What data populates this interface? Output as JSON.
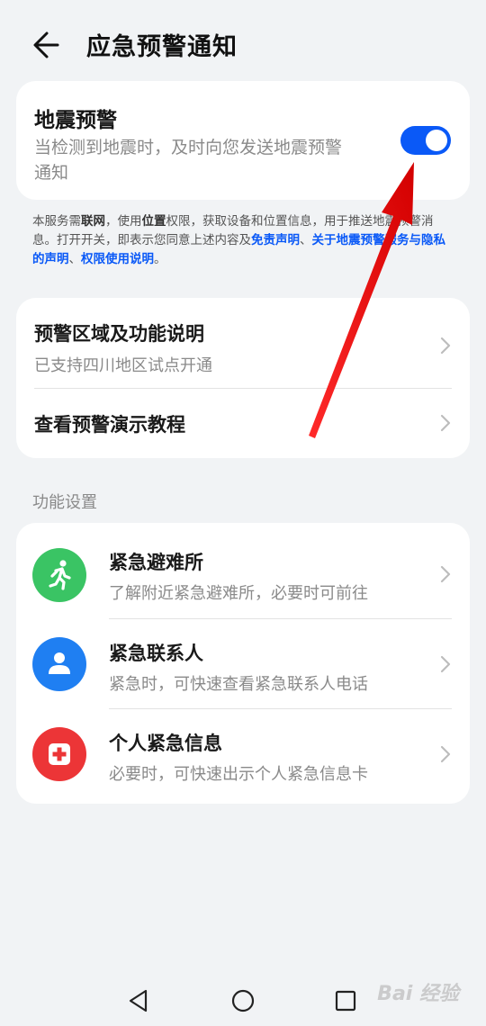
{
  "header": {
    "title": "应急预警通知"
  },
  "earthquake_card": {
    "title": "地震预警",
    "desc_line1": "当检测到地震时，及时向您发送地震预警",
    "desc_line2": "通知",
    "toggle_on": true,
    "toggle_color": "#0a59f7"
  },
  "notice": {
    "p1": "本服务需",
    "b1": "联网",
    "p2": "，使用",
    "b2": "位置",
    "p3": "权限，获取设备和位置信息，用于推送地震预警消息。打开开关，即表示您同意上述内容及",
    "link1": "免责声明",
    "p4": "、",
    "link2": "关于地震预警服务与隐私的声明",
    "p5": "、",
    "link3": "权限使用说明",
    "p6": "。"
  },
  "info_card": {
    "rows": [
      {
        "title": "预警区域及功能说明",
        "subtitle": "已支持四川地区试点开通"
      },
      {
        "title": "查看预警演示教程"
      }
    ]
  },
  "section_label": "功能设置",
  "features": [
    {
      "title": "紧急避难所",
      "subtitle": "了解附近紧急避难所，必要时可前往",
      "icon": "running-person-icon",
      "color": "#3ac464"
    },
    {
      "title": "紧急联系人",
      "subtitle": "紧急时，可快速查看紧急联系人电话",
      "icon": "person-icon",
      "color": "#1f7ff2"
    },
    {
      "title": "个人紧急信息",
      "subtitle": "必要时，可快速出示个人紧急信息卡",
      "icon": "medical-cross-icon",
      "color": "#ec3537"
    }
  ],
  "navbar": {
    "icons": [
      "back-triangle-icon",
      "home-circle-icon",
      "recent-square-icon"
    ]
  },
  "watermark": "Bai 经验"
}
